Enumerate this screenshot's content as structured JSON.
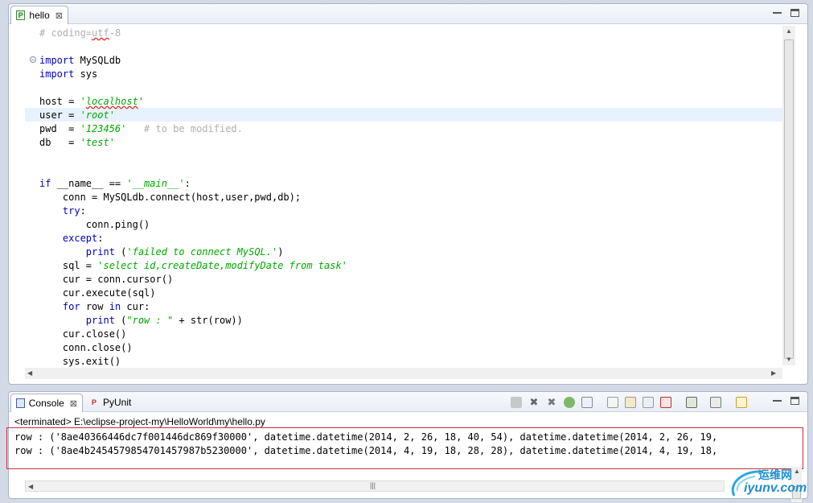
{
  "editor": {
    "tab_label": "hello",
    "tab_icon": "python-file-icon",
    "lines": [
      [
        {
          "t": "# coding=",
          "c": "cm"
        },
        {
          "t": "utf",
          "c": "cm sq"
        },
        {
          "t": "-8",
          "c": "cm"
        }
      ],
      [],
      [
        {
          "t": "import",
          "c": "kw"
        },
        {
          "t": " MySQLdb",
          "c": ""
        }
      ],
      [
        {
          "t": "import",
          "c": "kw"
        },
        {
          "t": " sys",
          "c": ""
        }
      ],
      [],
      [
        {
          "t": "host = ",
          "c": ""
        },
        {
          "t": "'",
          "c": "str"
        },
        {
          "t": "localhost",
          "c": "str sq"
        },
        {
          "t": "'",
          "c": "str"
        }
      ],
      [
        {
          "t": "user = ",
          "c": ""
        },
        {
          "t": "'root'",
          "c": "str"
        }
      ],
      [
        {
          "t": "pwd  = ",
          "c": ""
        },
        {
          "t": "'123456'",
          "c": "str"
        },
        {
          "t": "   # to be modified.",
          "c": "cm"
        }
      ],
      [
        {
          "t": "db   = ",
          "c": ""
        },
        {
          "t": "'test'",
          "c": "str"
        }
      ],
      [],
      [],
      [
        {
          "t": "if",
          "c": "kw"
        },
        {
          "t": " __name__ == ",
          "c": ""
        },
        {
          "t": "'__main__'",
          "c": "str"
        },
        {
          "t": ":",
          "c": ""
        }
      ],
      [
        {
          "t": "    conn = MySQLdb.connect(host,user,pwd,db);",
          "c": ""
        }
      ],
      [
        {
          "t": "    ",
          "c": ""
        },
        {
          "t": "try",
          "c": "kw"
        },
        {
          "t": ":",
          "c": ""
        }
      ],
      [
        {
          "t": "        conn.ping()",
          "c": ""
        }
      ],
      [
        {
          "t": "    ",
          "c": ""
        },
        {
          "t": "except",
          "c": "kw"
        },
        {
          "t": ":",
          "c": ""
        }
      ],
      [
        {
          "t": "        ",
          "c": ""
        },
        {
          "t": "print",
          "c": "kw"
        },
        {
          "t": " (",
          "c": ""
        },
        {
          "t": "'failed to connect MySQL.'",
          "c": "str"
        },
        {
          "t": ")",
          "c": ""
        }
      ],
      [
        {
          "t": "    sql = ",
          "c": ""
        },
        {
          "t": "'select id,createDate,modifyDate from task'",
          "c": "str"
        }
      ],
      [
        {
          "t": "    cur = conn.cursor()",
          "c": ""
        }
      ],
      [
        {
          "t": "    cur.execute(sql)",
          "c": ""
        }
      ],
      [
        {
          "t": "    ",
          "c": ""
        },
        {
          "t": "for",
          "c": "kw"
        },
        {
          "t": " row ",
          "c": ""
        },
        {
          "t": "in",
          "c": "kw"
        },
        {
          "t": " cur:",
          "c": ""
        }
      ],
      [
        {
          "t": "        ",
          "c": ""
        },
        {
          "t": "print",
          "c": "kw"
        },
        {
          "t": " (",
          "c": ""
        },
        {
          "t": "\"row : \"",
          "c": "str"
        },
        {
          "t": " + str(row))",
          "c": ""
        }
      ],
      [
        {
          "t": "    cur.close()",
          "c": ""
        }
      ],
      [
        {
          "t": "    conn.close()",
          "c": ""
        }
      ],
      [
        {
          "t": "    sys.exit()",
          "c": ""
        }
      ]
    ]
  },
  "console": {
    "tabs": [
      {
        "label": "Console",
        "icon": "console-icon"
      },
      {
        "label": "PyUnit",
        "icon": "pyunit-icon"
      }
    ],
    "toolbar_icons": [
      "terminate-icon",
      "remove-launch-icon",
      "remove-all-icon",
      "connect-icon",
      "copy-icon",
      "clear-console-icon",
      "scroll-lock-icon",
      "word-wrap-icon",
      "pin-icon",
      "display-console-icon",
      "open-console-icon"
    ],
    "terminated_line": "<terminated> E:\\eclipse-project-my\\HelloWorld\\my\\hello.py",
    "output": [
      "row : ('8ae40366446dc7f001446dc869f30000', datetime.datetime(2014, 2, 26, 18, 40, 54), datetime.datetime(2014, 2, 26, 19,",
      "row : ('8ae4b2454579854701457987b5230000', datetime.datetime(2014, 4, 19, 18, 28, 28), datetime.datetime(2014, 4, 19, 18,"
    ]
  },
  "watermark": {
    "cn": "运维网",
    "url": "iyunv.com"
  }
}
